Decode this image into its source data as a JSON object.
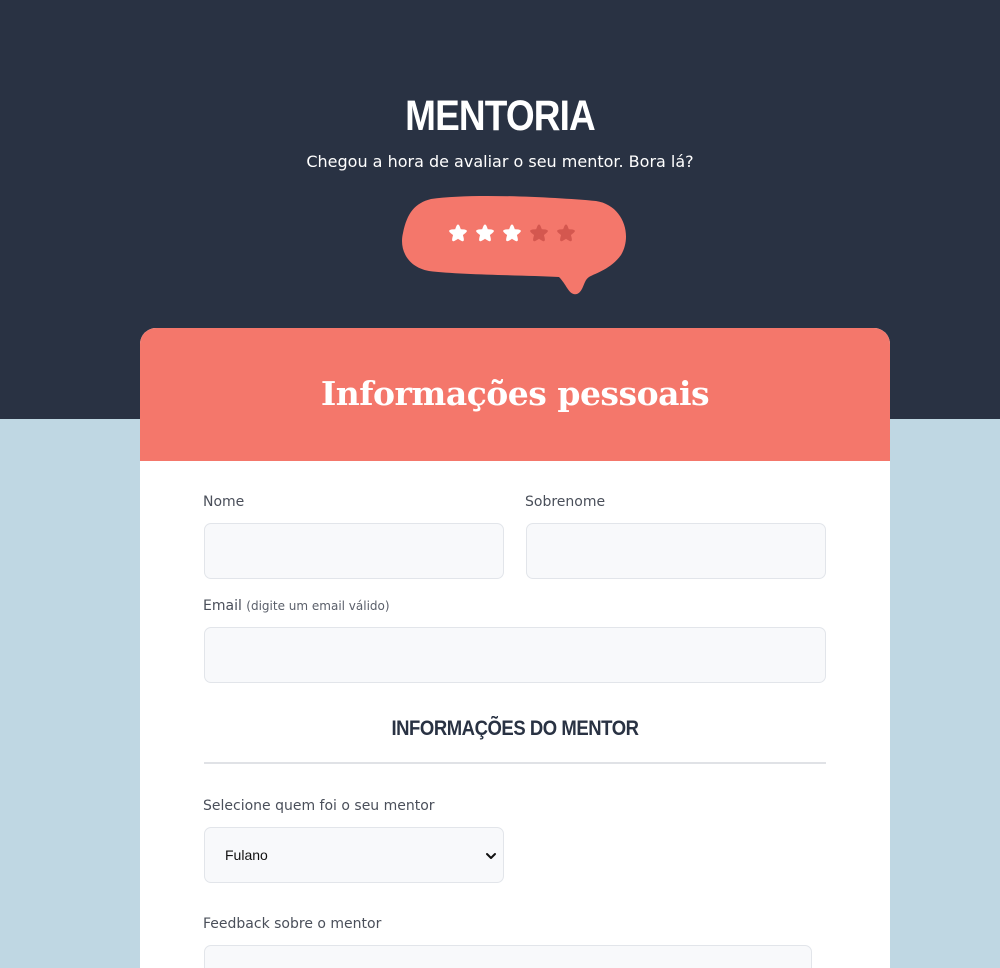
{
  "hero": {
    "title": "MENTORIA",
    "subtitle": "Chegou a hora de avaliar o seu mentor. Bora lá?",
    "rating": {
      "value": 3,
      "max": 5
    },
    "colors": {
      "bubble": "#f4776b",
      "star_on": "#ffffff",
      "star_off": "#d4574f"
    }
  },
  "form": {
    "header_title": "Informações pessoais",
    "first_name_label": "Nome",
    "first_name_value": "",
    "last_name_label": "Sobrenome",
    "last_name_value": "",
    "email_label": "Email",
    "email_hint": "(digite um email válido)",
    "email_value": "",
    "mentor_section_title": "INFORMAÇÕES DO MENTOR",
    "mentor_select_label": "Selecione quem foi o seu mentor",
    "mentor_select_value": "Fulano",
    "feedback_label": "Feedback sobre o mentor"
  },
  "colors": {
    "top_background": "#293243",
    "page_background": "#bfd7e3",
    "accent": "#f4776b"
  }
}
